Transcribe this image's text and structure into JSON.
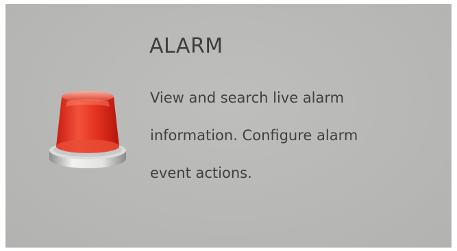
{
  "tile": {
    "title": "ALARM",
    "description_lines": [
      "View and search live alarm",
      "information. Configure alarm",
      "event actions."
    ],
    "icon": "alarm-beacon-icon"
  },
  "colors": {
    "tile_background": "#b8b8b6",
    "text": "#404040",
    "beacon_red": "#e0321f",
    "beacon_base": "#d0d0d0"
  }
}
